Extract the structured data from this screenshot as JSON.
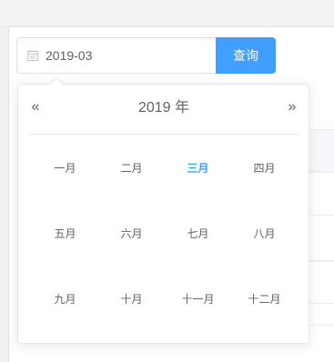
{
  "filter": {
    "date_value": "2019-03",
    "query_label": "查询"
  },
  "picker": {
    "year_label": "2019 年",
    "prev_year_glyph": "«",
    "next_year_glyph": "»",
    "months": [
      "一月",
      "二月",
      "三月",
      "四月",
      "五月",
      "六月",
      "七月",
      "八月",
      "九月",
      "十月",
      "十一月",
      "十二月"
    ],
    "selected_month_index": 2
  },
  "colors": {
    "accent": "#409eff",
    "text": "#606266",
    "border": "#dcdfe6"
  },
  "icons": {
    "date_input": "calendar-icon",
    "prev_year": "double-chevron-left-icon",
    "next_year": "double-chevron-right-icon"
  }
}
